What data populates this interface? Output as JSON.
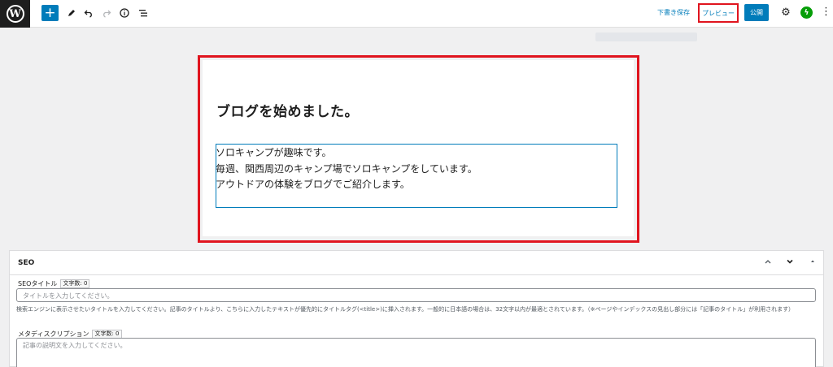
{
  "toolbar": {
    "logo": "W",
    "add_block": "+",
    "tools_icon": "pencil-icon",
    "undo_icon": "undo-icon",
    "redo_icon": "redo-icon",
    "info_icon": "info-icon",
    "list_view_icon": "list-view-icon",
    "save_draft_label": "下書き保存",
    "preview_label": "プレビュー",
    "publish_label": "公開",
    "settings_icon": "gear-icon",
    "jetpack_icon": "jetpack-icon",
    "more_icon": "⋮"
  },
  "post": {
    "title": "ブログを始めました。",
    "paragraph_lines": [
      "ソロキャンプが趣味です。",
      "毎週、関西周辺のキャンプ場でソロキャンプをしています。",
      "アウトドアの体験をブログでご紹介します。"
    ]
  },
  "seo": {
    "header": "SEO",
    "title_label": "SEOタイトル",
    "title_counter": "文字数: 0",
    "title_placeholder": "タイトルを入力してください。",
    "title_help": "検索エンジンに表示させたいタイトルを入力してください。記事のタイトルより、こちらに入力したテキストが優先的にタイトルタグ(<title>)に挿入されます。一般的に日本語の場合は、32文字以内が最適とされています。（※ページやインデックスの見出し部分には「記事のタイトル」が利用されます）",
    "desc_label": "メタディスクリプション",
    "desc_counter": "文字数: 0",
    "desc_placeholder": "記事の説明文を入力してください。"
  },
  "colors": {
    "accent": "#007cba",
    "highlight": "#e0141e",
    "jetpack": "#069e08"
  }
}
